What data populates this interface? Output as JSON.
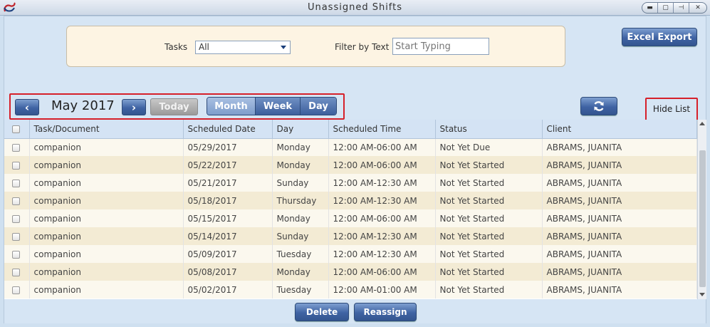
{
  "window": {
    "title": "Unassigned Shifts",
    "controls": [
      "minimize",
      "restore",
      "pin",
      "close"
    ]
  },
  "filters": {
    "tasks_label": "Tasks",
    "tasks_value": "All",
    "text_label": "Filter by Text",
    "text_placeholder": "Start Typing"
  },
  "toolbar": {
    "excel_export": "Excel Export",
    "month_year": "May 2017",
    "today": "Today",
    "views": [
      "Month",
      "Week",
      "Day"
    ],
    "active_view": "Month",
    "hide_list": "Hide List"
  },
  "table": {
    "columns": [
      "Task/Document",
      "Scheduled Date",
      "Day",
      "Scheduled Time",
      "Status",
      "Client"
    ],
    "rows": [
      [
        "companion",
        "05/29/2017",
        "Monday",
        "12:00 AM-06:00 AM",
        "Not Yet Due",
        "ABRAMS, JUANITA"
      ],
      [
        "companion",
        "05/22/2017",
        "Monday",
        "12:00 AM-06:00 AM",
        "Not Yet Started",
        "ABRAMS, JUANITA"
      ],
      [
        "companion",
        "05/21/2017",
        "Sunday",
        "12:00 AM-12:30 AM",
        "Not Yet Started",
        "ABRAMS, JUANITA"
      ],
      [
        "companion",
        "05/18/2017",
        "Thursday",
        "12:00 AM-12:30 AM",
        "Not Yet Started",
        "ABRAMS, JUANITA"
      ],
      [
        "companion",
        "05/15/2017",
        "Monday",
        "12:00 AM-06:00 AM",
        "Not Yet Started",
        "ABRAMS, JUANITA"
      ],
      [
        "companion",
        "05/14/2017",
        "Sunday",
        "12:00 AM-12:30 AM",
        "Not Yet Started",
        "ABRAMS, JUANITA"
      ],
      [
        "companion",
        "05/09/2017",
        "Tuesday",
        "12:00 AM-12:30 AM",
        "Not Yet Started",
        "ABRAMS, JUANITA"
      ],
      [
        "companion",
        "05/08/2017",
        "Monday",
        "12:00 AM-06:00 AM",
        "Not Yet Started",
        "ABRAMS, JUANITA"
      ],
      [
        "companion",
        "05/02/2017",
        "Tuesday",
        "12:00 AM-01:00 AM",
        "Not Yet Started",
        "ABRAMS, JUANITA"
      ]
    ]
  },
  "footer": {
    "delete": "Delete",
    "reassign": "Reassign"
  },
  "colors": {
    "highlight_border": "#d6202a",
    "button_blue": "#3f63a3",
    "row_odd": "#fbf8ee",
    "row_even": "#f3ebd4",
    "filter_panel": "#fdf4e3"
  },
  "icons": {
    "prev": "chevron-left-icon",
    "next": "chevron-right-icon",
    "refresh": "refresh-icon",
    "dropdown": "chevron-down-icon"
  }
}
